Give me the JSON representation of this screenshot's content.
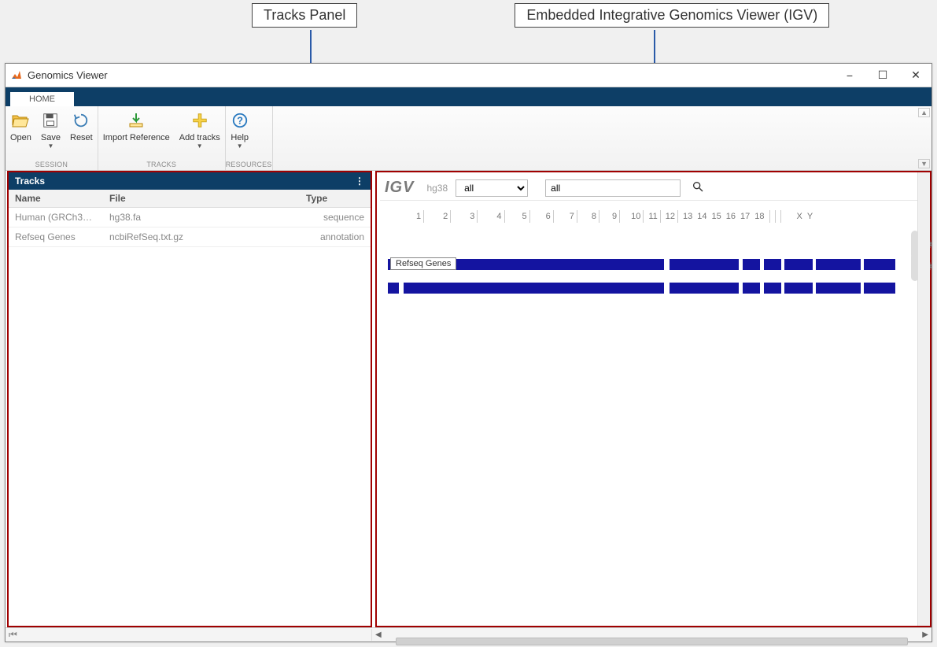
{
  "callouts": {
    "left": "Tracks Panel",
    "right": "Embedded Integrative Genomics Viewer (IGV)"
  },
  "window": {
    "title": "Genomics Viewer"
  },
  "tabs": {
    "home": "HOME"
  },
  "toolstrip": {
    "open": "Open",
    "save": "Save",
    "reset": "Reset",
    "import_ref": "Import Reference",
    "add_tracks": "Add tracks",
    "help": "Help",
    "group_session": "SESSION",
    "group_tracks": "TRACKS",
    "group_resources": "RESOURCES"
  },
  "tracks_panel": {
    "title": "Tracks",
    "columns": {
      "name": "Name",
      "file": "File",
      "type": "Type"
    },
    "rows": [
      {
        "name": "Human (GRCh3…",
        "file": "hg38.fa",
        "type": "sequence"
      },
      {
        "name": "Refseq Genes",
        "file": "ncbiRefSeq.txt.gz",
        "type": "annotation"
      }
    ]
  },
  "igv": {
    "logo": "IGV",
    "reference": "hg38",
    "chrom_select": "all",
    "search_value": "all",
    "chromosomes": [
      "1",
      "2",
      "3",
      "4",
      "5",
      "6",
      "7",
      "8",
      "9",
      "10",
      "11",
      "12",
      "13",
      "14",
      "15",
      "16",
      "17",
      "18",
      "X",
      "Y"
    ],
    "track_label": "Refseq Genes"
  }
}
